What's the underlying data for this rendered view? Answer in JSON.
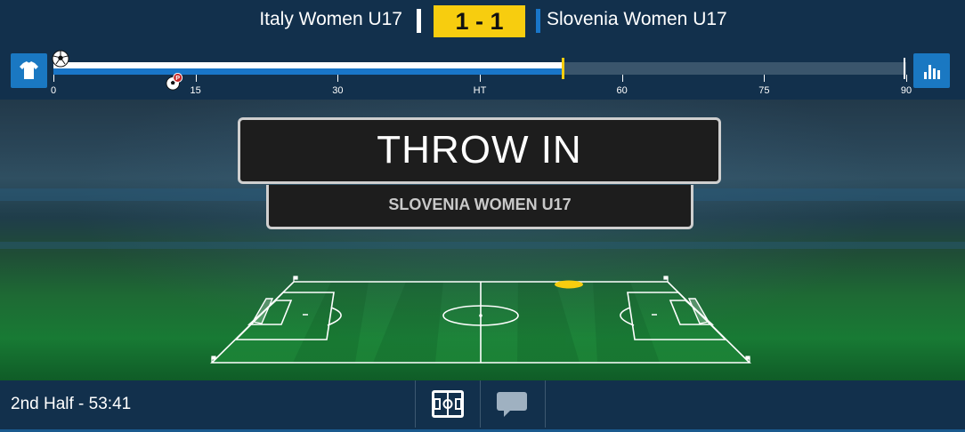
{
  "match": {
    "home_team": "Italy Women U17",
    "away_team": "Slovenia Women U17",
    "score": "1 - 1",
    "colors": {
      "score_bg": "#f7cd0f",
      "home": "#ffffff",
      "away": "#1976c9"
    }
  },
  "timeline": {
    "ticks": [
      {
        "minute": 0,
        "label": "0"
      },
      {
        "minute": 15,
        "label": "15"
      },
      {
        "minute": 30,
        "label": "30"
      },
      {
        "minute": 45,
        "label": "HT"
      },
      {
        "minute": 60,
        "label": "60"
      },
      {
        "minute": 75,
        "label": "75"
      },
      {
        "minute": 90,
        "label": "90"
      }
    ],
    "current_minute": 53.7,
    "full_minutes": 90,
    "events": [
      {
        "type": "goal",
        "minute": 0.5,
        "icon": "soccer-ball-icon"
      },
      {
        "type": "penalty-goal",
        "minute": 13,
        "icon": "penalty-ball-icon",
        "badge": "P"
      }
    ],
    "left_button_icon": "jersey-icon",
    "right_button_icon": "stats-bars-icon"
  },
  "event": {
    "title": "THROW IN",
    "team": "SLOVENIA WOMEN U17",
    "marker_color": "#f7cd0f"
  },
  "footer": {
    "match_time": "2nd Half - 53:41",
    "buttons": [
      {
        "name": "pitch-view",
        "icon": "pitch-icon"
      },
      {
        "name": "commentary",
        "icon": "chat-bubble-icon"
      }
    ]
  }
}
